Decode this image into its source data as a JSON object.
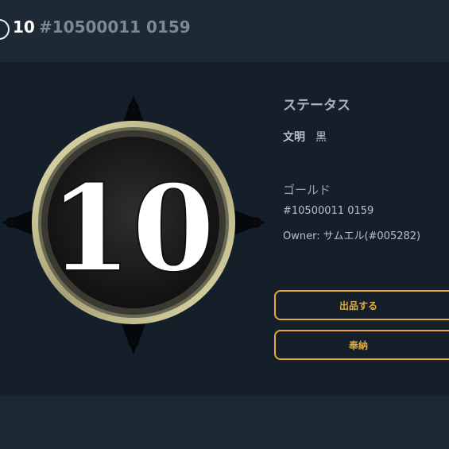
{
  "header": {
    "title_number": "10",
    "title_id": "#10500011 0159"
  },
  "coin": {
    "number": "10",
    "rim_color": "#c9c48e",
    "face_color": "#1a1a1a",
    "numeral_color": "#ffffff"
  },
  "status": {
    "heading": "ステータス",
    "civ_label": "文明",
    "civ_value": "黒"
  },
  "gold": {
    "label": "ゴールド",
    "id": "#10500011 0159",
    "owner": "Owner: サムエル(#005282)"
  },
  "actions": {
    "list_label": "出品する",
    "offer_label": "奉納"
  },
  "colors": {
    "accent": "#e2a93b",
    "background": "#1b2733",
    "panel": "#151f29"
  }
}
